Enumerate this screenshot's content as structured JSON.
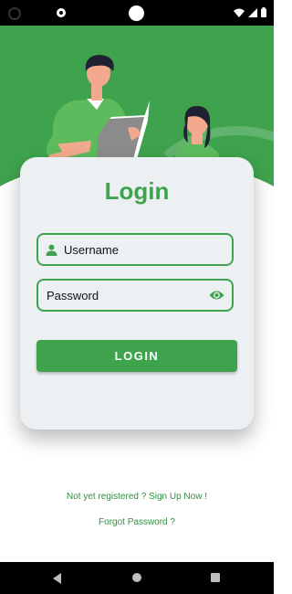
{
  "login": {
    "title": "Login",
    "username_label": "Username",
    "password_label": "Password",
    "button_label": "LOGIN"
  },
  "links": {
    "signup": "Not yet registered ? Sign Up Now !",
    "forgot": "Forgot Password ?"
  },
  "icons": {
    "user": "person-icon",
    "password_toggle": "eye-icon"
  },
  "colors": {
    "primary": "#3fa34d",
    "card": "#edf0f3",
    "link": "#2f8f3e"
  }
}
